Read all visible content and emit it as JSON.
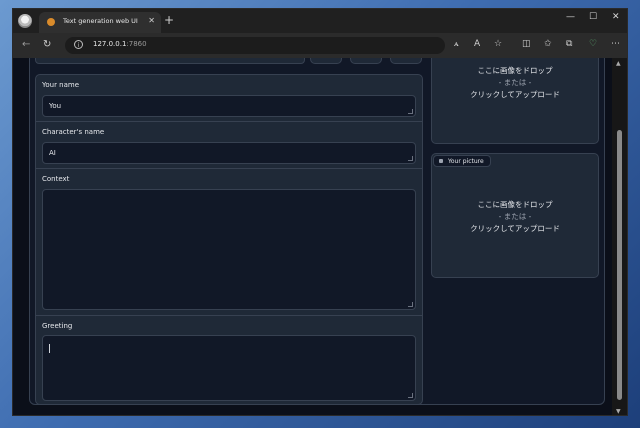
{
  "browser": {
    "tab_title": "Text generation web UI",
    "url_host": "127.0.0.1",
    "url_port": ":7860"
  },
  "form": {
    "your_name_label": "Your name",
    "your_name_value": "You",
    "character_name_label": "Character's name",
    "character_name_value": "AI",
    "context_label": "Context",
    "context_value": "",
    "greeting_label": "Greeting",
    "greeting_value": ""
  },
  "character_picture": {
    "drop_line1": "ここに画像をドロップ",
    "drop_line2": "- または -",
    "drop_line3": "クリックしてアップロード"
  },
  "your_picture": {
    "label": "Your picture",
    "drop_line1": "ここに画像をドロップ",
    "drop_line2": "- または -",
    "drop_line3": "クリックしてアップロード"
  },
  "colors": {
    "page_bg": "#0b0f19",
    "panel_bg": "#1f2937",
    "border": "#374151",
    "accent": "#3b82f6"
  }
}
